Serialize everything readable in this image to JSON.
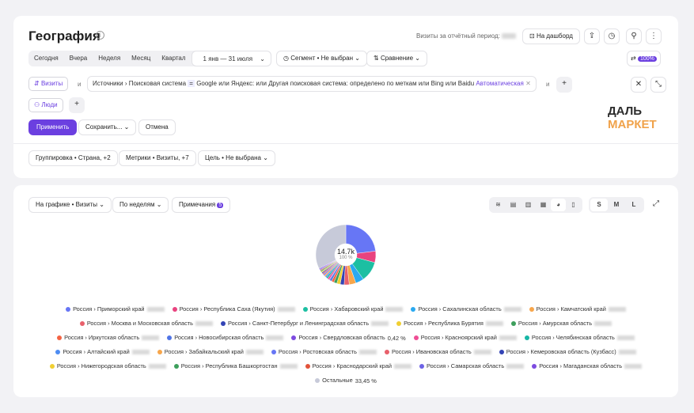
{
  "header": {
    "title": "География",
    "visits_label": "Визиты за отчётный период:",
    "dashboard_label": "На дашборд"
  },
  "period": {
    "items": [
      "Сегодня",
      "Вчера",
      "Неделя",
      "Месяц",
      "Квартал"
    ],
    "range": "1 янв — 31 июля",
    "segment": "Сегмент • Не выбран",
    "comparison": "Сравнение",
    "sampling_badge": "100%"
  },
  "filters": {
    "visits_chip": "Визиты",
    "and_text": "и",
    "source_text": "Источники › Поисковая система",
    "op": "=",
    "values_text": "Google или Яндекс: или Другая поисковая система: определено по меткам или Bing или Baidu",
    "auto_label": "Автоматическая",
    "people_chip": "Люди"
  },
  "actions": {
    "apply": "Применить",
    "save": "Сохранить...",
    "cancel": "Отмена"
  },
  "logo": {
    "line1": "ДАЛЬ",
    "line2": "МАРКЕТ"
  },
  "settings": {
    "grouping": "Группировка • Страна, +2",
    "metrics": "Метрики • Визиты, +7",
    "goal": "Цель • Не выбрана"
  },
  "chart_controls": {
    "on_chart": "На графике • Визиты",
    "by_weeks": "По неделям",
    "notes": "Примечания",
    "notes_count": "5",
    "sizes": [
      "S",
      "M",
      "L"
    ]
  },
  "chart_data": {
    "type": "pie",
    "total": "14.7k",
    "total_pct": "100 %",
    "slices": [
      {
        "label": "Россия › Приморский край",
        "color": "#6776f5",
        "value": 23.7
      },
      {
        "label": "Россия › Республика Саха (Якутия)",
        "color": "#e9437f",
        "value": 6.3
      },
      {
        "label": "Россия › Хабаровский край",
        "color": "#1cbfa2",
        "value": 11.2
      },
      {
        "label": "Россия › Сахалинская область",
        "color": "#2aa9f0",
        "value": 4.6
      },
      {
        "label": "Россия › Камчатский край",
        "color": "#f7a64b",
        "value": 3.7
      },
      {
        "label": "Россия › Москва и Московская область",
        "color": "#e8606b",
        "value": 2.8
      },
      {
        "label": "Россия › Санкт-Петербург и Ленинградская область",
        "color": "#3344b5",
        "value": 2.2
      },
      {
        "label": "Россия › Республика Бурятия",
        "color": "#f0cf32",
        "value": 1.9
      },
      {
        "label": "Россия › Амурская область",
        "color": "#3d9f5c",
        "value": 1.7
      },
      {
        "label": "Россия › Иркутская область",
        "color": "#f46343",
        "value": 1.4
      },
      {
        "label": "Россия › Новосибирская область",
        "color": "#4f74e6",
        "value": 1.2
      },
      {
        "label": "Россия › Свердловская область",
        "color": "#7d4be0",
        "value": 0.42
      },
      {
        "label": "Россия › Красноярский край",
        "color": "#ef4e95",
        "value": 1.0
      },
      {
        "label": "Россия › Челябинская область",
        "color": "#17b6a6",
        "value": 0.9
      },
      {
        "label": "Россия › Алтайский край",
        "color": "#4d8cf2",
        "value": 0.8
      },
      {
        "label": "Россия › Забайкальский край",
        "color": "#f7a64b",
        "value": 0.8
      },
      {
        "label": "Россия › Ростовская область",
        "color": "#6776f5",
        "value": 0.7
      },
      {
        "label": "Россия › Ивановская область",
        "color": "#e8606b",
        "value": 0.7
      },
      {
        "label": "Россия › Кемеровская область (Кузбасс)",
        "color": "#3344b5",
        "value": 0.6
      },
      {
        "label": "Россия › Нижегородская область",
        "color": "#f0cf32",
        "value": 0.6
      },
      {
        "label": "Россия › Республика Башкортостан",
        "color": "#3d9f5c",
        "value": 0.6
      },
      {
        "label": "Россия › Краснодарский край",
        "color": "#e2533a",
        "value": 0.5
      },
      {
        "label": "Россия › Самарская область",
        "color": "#6e63e6",
        "value": 0.5
      },
      {
        "label": "Россия › Магаданская область",
        "color": "#7d4be0",
        "value": 0.5
      },
      {
        "label": "Остальные",
        "color": "#c7cad9",
        "value": 33.45
      }
    ],
    "shown_values": {
      "sverdlovsk": "0,42 %",
      "others": "33,45 %"
    }
  }
}
